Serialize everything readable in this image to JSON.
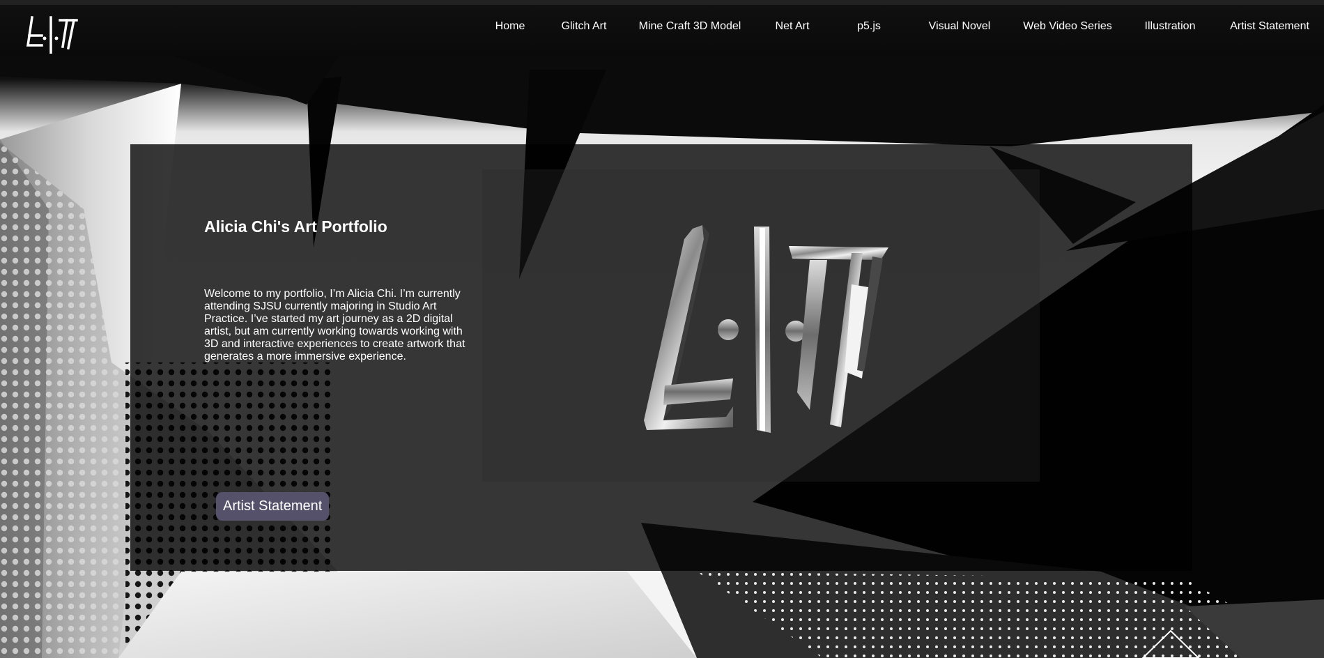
{
  "header": {
    "logo_icon": "ai-monogram-logo",
    "nav": [
      {
        "label": "Home"
      },
      {
        "label": "Glitch Art"
      },
      {
        "label": "Mine Craft 3D Model"
      },
      {
        "label": "Net Art"
      },
      {
        "label": "p5.js"
      },
      {
        "label": "Visual Novel"
      },
      {
        "label": "Web Video Series"
      },
      {
        "label": "Illustration"
      },
      {
        "label": "Artist Statement"
      }
    ]
  },
  "hero": {
    "title": "Alicia Chi's Art Portfolio",
    "intro": "Welcome to my portfolio, I’m Alicia Chi. I’m currently attending SJSU currently majoring in Studio Art Practice. I’ve started my art journey as a 2D digital artist, but am currently working towards working with 3D and interactive experiences to create artwork that generates a more immersive experience.",
    "cta_label": "Artist Statement",
    "media_icon": "3d-monogram-logo"
  },
  "colors": {
    "background": "#0c0c0c",
    "panel": "#000000",
    "button": "#56516a",
    "text": "#ffffff"
  }
}
